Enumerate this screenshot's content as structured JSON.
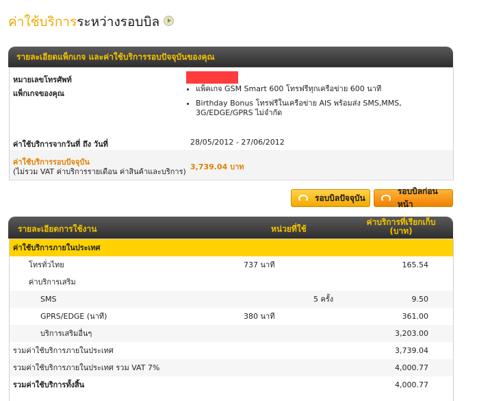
{
  "header": {
    "title_part1": "ค่าใช้บริการ",
    "title_part2": "ระหว่างรอบบิล"
  },
  "package_panel": {
    "heading": "รายละเอียดแพ็กเกจ และค่าใช้บริการรอบปัจจุบันของคุณ",
    "phone_label": "หมายเลขโทรศัพท์",
    "package_label": "แพ็กเกจของคุณ",
    "package_items": [
      "แพ็คเกจ GSM Smart 600 โทรฟรีทุกเครือข่าย 600 นาที",
      "Birthday Bonus โทรฟรีในเครือข่าย AIS พร้อมส่ง SMS,MMS, 3G/EDGE/GPRS ไม่จำกัด"
    ],
    "period_label": "ค่าใช้บริการจากวันที่ ถึง วันที่",
    "period_value": "28/05/2012 - 27/06/2012",
    "current_label": "ค่าใช้บริการรอบปัจจุบัน",
    "current_note": "(ไม่รวม VAT ค่าบริการรายเดือน ค่าสินค้าและบริการ)",
    "current_value": "3,739.04 บาท"
  },
  "buttons": {
    "current_bill": "รอบบิลปัจจุบัน",
    "previous_bill": "รอบบิลก่อนหน้า"
  },
  "colors": {
    "accent": "#f3c200",
    "orange_text": "#e08000",
    "button_bg": "#f5a800",
    "redaction": "#ff3b3b"
  },
  "usage_table": {
    "col_detail": "รายละเอียดการใช้งาน",
    "col_units": "หน่วยที่ใช้",
    "col_charge_1": "ค่าบริการที่เรียกเก็บ",
    "col_charge_2": "(บาท)",
    "section_domestic": "ค่าใช้บริการภายในประเทศ",
    "rows": [
      {
        "label": "โทรทั่วไทย",
        "units": "737 นาที",
        "units2": "",
        "amount": "165.54"
      },
      {
        "label": "ค่าบริการเสริม",
        "units": "",
        "units2": "",
        "amount": ""
      },
      {
        "label": "SMS",
        "units": "",
        "units2": "5 ครั้ง",
        "amount": "9.50"
      },
      {
        "label": "GPRS/EDGE (นาที)",
        "units": "380 นาที",
        "units2": "",
        "amount": "361.00"
      },
      {
        "label": "บริการเสริมอื่นๆ",
        "units": "",
        "units2": "",
        "amount": "3,203.00"
      },
      {
        "label": "รวมค่าใช้บริการภายในประเทศ",
        "units": "",
        "units2": "",
        "amount": "3,739.04"
      },
      {
        "label": "รวมค่าใช้บริการภายในประเทศ รวม VAT 7%",
        "units": "",
        "units2": "",
        "amount": "4,000.77"
      },
      {
        "label": "รวมค่าใช้บริการทั้งสิ้น",
        "units": "",
        "units2": "",
        "amount": "4,000.77"
      }
    ]
  }
}
